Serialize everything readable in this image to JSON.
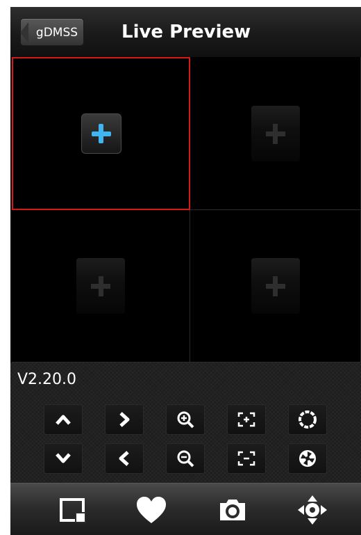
{
  "header": {
    "back_label": "gDMSS",
    "title": "Live Preview"
  },
  "grid": {
    "cells": [
      {
        "name": "video-cell-1",
        "state": "selected"
      },
      {
        "name": "video-cell-2",
        "state": "empty"
      },
      {
        "name": "video-cell-3",
        "state": "empty"
      },
      {
        "name": "video-cell-4",
        "state": "empty"
      }
    ]
  },
  "controls": {
    "version": "V2.20.0",
    "row1": [
      "ptz-up-icon",
      "ptz-right-icon",
      "zoom-in-icon",
      "focus-near-icon",
      "iris-open-icon"
    ],
    "row2": [
      "ptz-down-icon",
      "ptz-left-icon",
      "zoom-out-icon",
      "focus-far-icon",
      "iris-close-icon"
    ]
  },
  "toolbar": {
    "items": [
      "screen-layout-icon",
      "favorites-heart-icon",
      "snapshot-camera-icon",
      "ptz-direction-icon"
    ]
  },
  "colors": {
    "accent_blue": "#3fb6f0",
    "selection_red": "#d21a1a",
    "background": "#000000"
  }
}
